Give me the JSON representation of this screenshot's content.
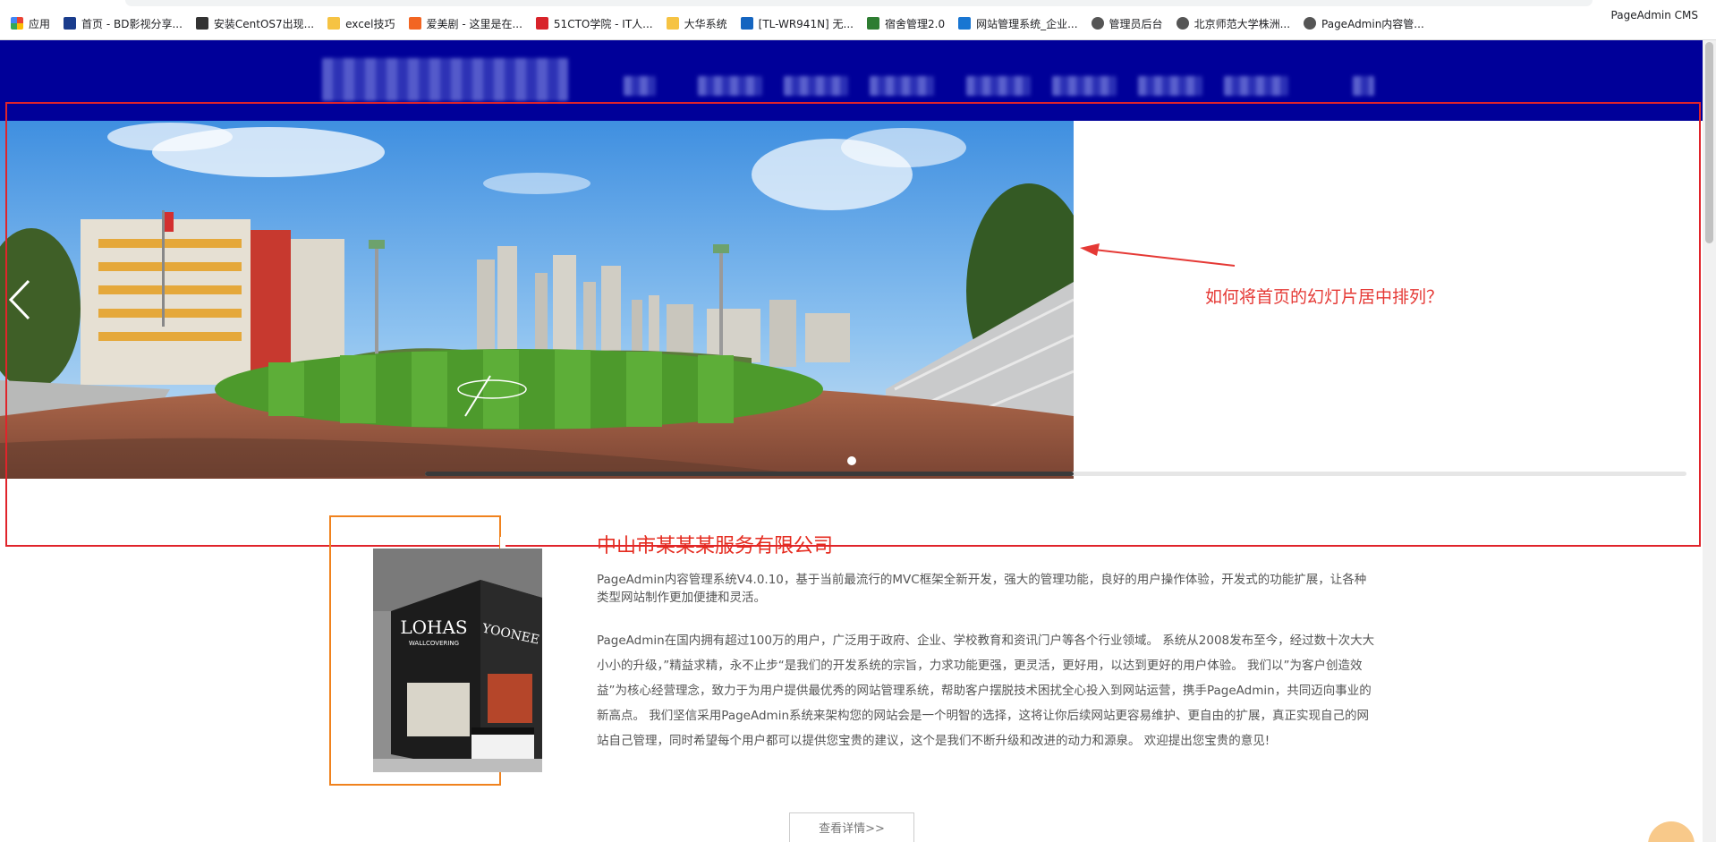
{
  "bookmarks": {
    "items": [
      {
        "label": "应用",
        "icon": "apps-grid-icon",
        "color": "#4285f4"
      },
      {
        "label": "首页 - BD影视分享...",
        "icon": "site-favicon",
        "color": "#1a3c8c"
      },
      {
        "label": "安装CentOS7出现...",
        "icon": "bird-icon",
        "color": "#333333"
      },
      {
        "label": "excel技巧",
        "icon": "folder-icon",
        "color": "#f6c343"
      },
      {
        "label": "爱美剧 - 这里是在...",
        "icon": "tv-icon",
        "color": "#f26522"
      },
      {
        "label": "51CTO学院 - IT人...",
        "icon": "51cto-icon",
        "color": "#d8232a"
      },
      {
        "label": "大华系统",
        "icon": "folder-icon",
        "color": "#f6c343"
      },
      {
        "label": "[TL-WR941N] 无...",
        "icon": "tplink-icon",
        "color": "#1565c0"
      },
      {
        "label": "宿舍管理2.0",
        "icon": "vue-icon",
        "color": "#2e7d32"
      },
      {
        "label": "网站管理系统_企业...",
        "icon": "pageadmin-icon",
        "color": "#1976d2"
      },
      {
        "label": "管理员后台",
        "icon": "globe-icon",
        "color": "#555555"
      },
      {
        "label": "北京师范大学株洲...",
        "icon": "globe-icon",
        "color": "#555555"
      },
      {
        "label": "PageAdmin内容管...",
        "icon": "globe-icon",
        "color": "#555555"
      }
    ],
    "right_label": "PageAdmin CMS"
  },
  "header": {
    "background": "#000099"
  },
  "slider": {
    "active_dot": 1
  },
  "annotation": {
    "question": "如何将首页的幻灯片居中排列？",
    "color": "#e53935"
  },
  "about": {
    "title": "中山市某某某服务有限公司",
    "paragraph1": "PageAdmin内容管理系统V4.0.10，基于当前最流行的MVC框架全新开发，强大的管理功能，良好的用户操作体验，开发式的功能扩展，让各种类型网站制作更加便捷和灵活。",
    "paragraph2": "PageAdmin在国内拥有超过100万的用户，广泛用于政府、企业、学校教育和资讯门户等各个行业领域。 系统从2008发布至今，经过数十次大大小小的升级，”精益求精，永不止步“是我们的开发系统的宗旨，力求功能更强，更灵活，更好用，以达到更好的用户体验。 我们以”为客户创造效益”为核心经营理念，致力于为用户提供最优秀的网站管理系统，帮助客户摆脱技术困扰全心投入到网站运营，携手PageAdmin，共同迈向事业的新高点。 我们坚信采用PageAdmin系统来架构您的网站会是一个明智的选择，这将让你后续网站更容易维护、更自由的扩展，真正实现自己的网站自己管理，同时希望每个用户都可以提供您宝贵的建议，这个是我们不断升级和改进的动力和源泉。 欢迎提出您宝贵的意见!",
    "more_button": "查看详情>>",
    "title_color": "#e52b1f",
    "frame_color": "#f0821e",
    "showroom_signage": [
      "LOHAS",
      "WALLCOVERING",
      "YOONEE"
    ]
  }
}
